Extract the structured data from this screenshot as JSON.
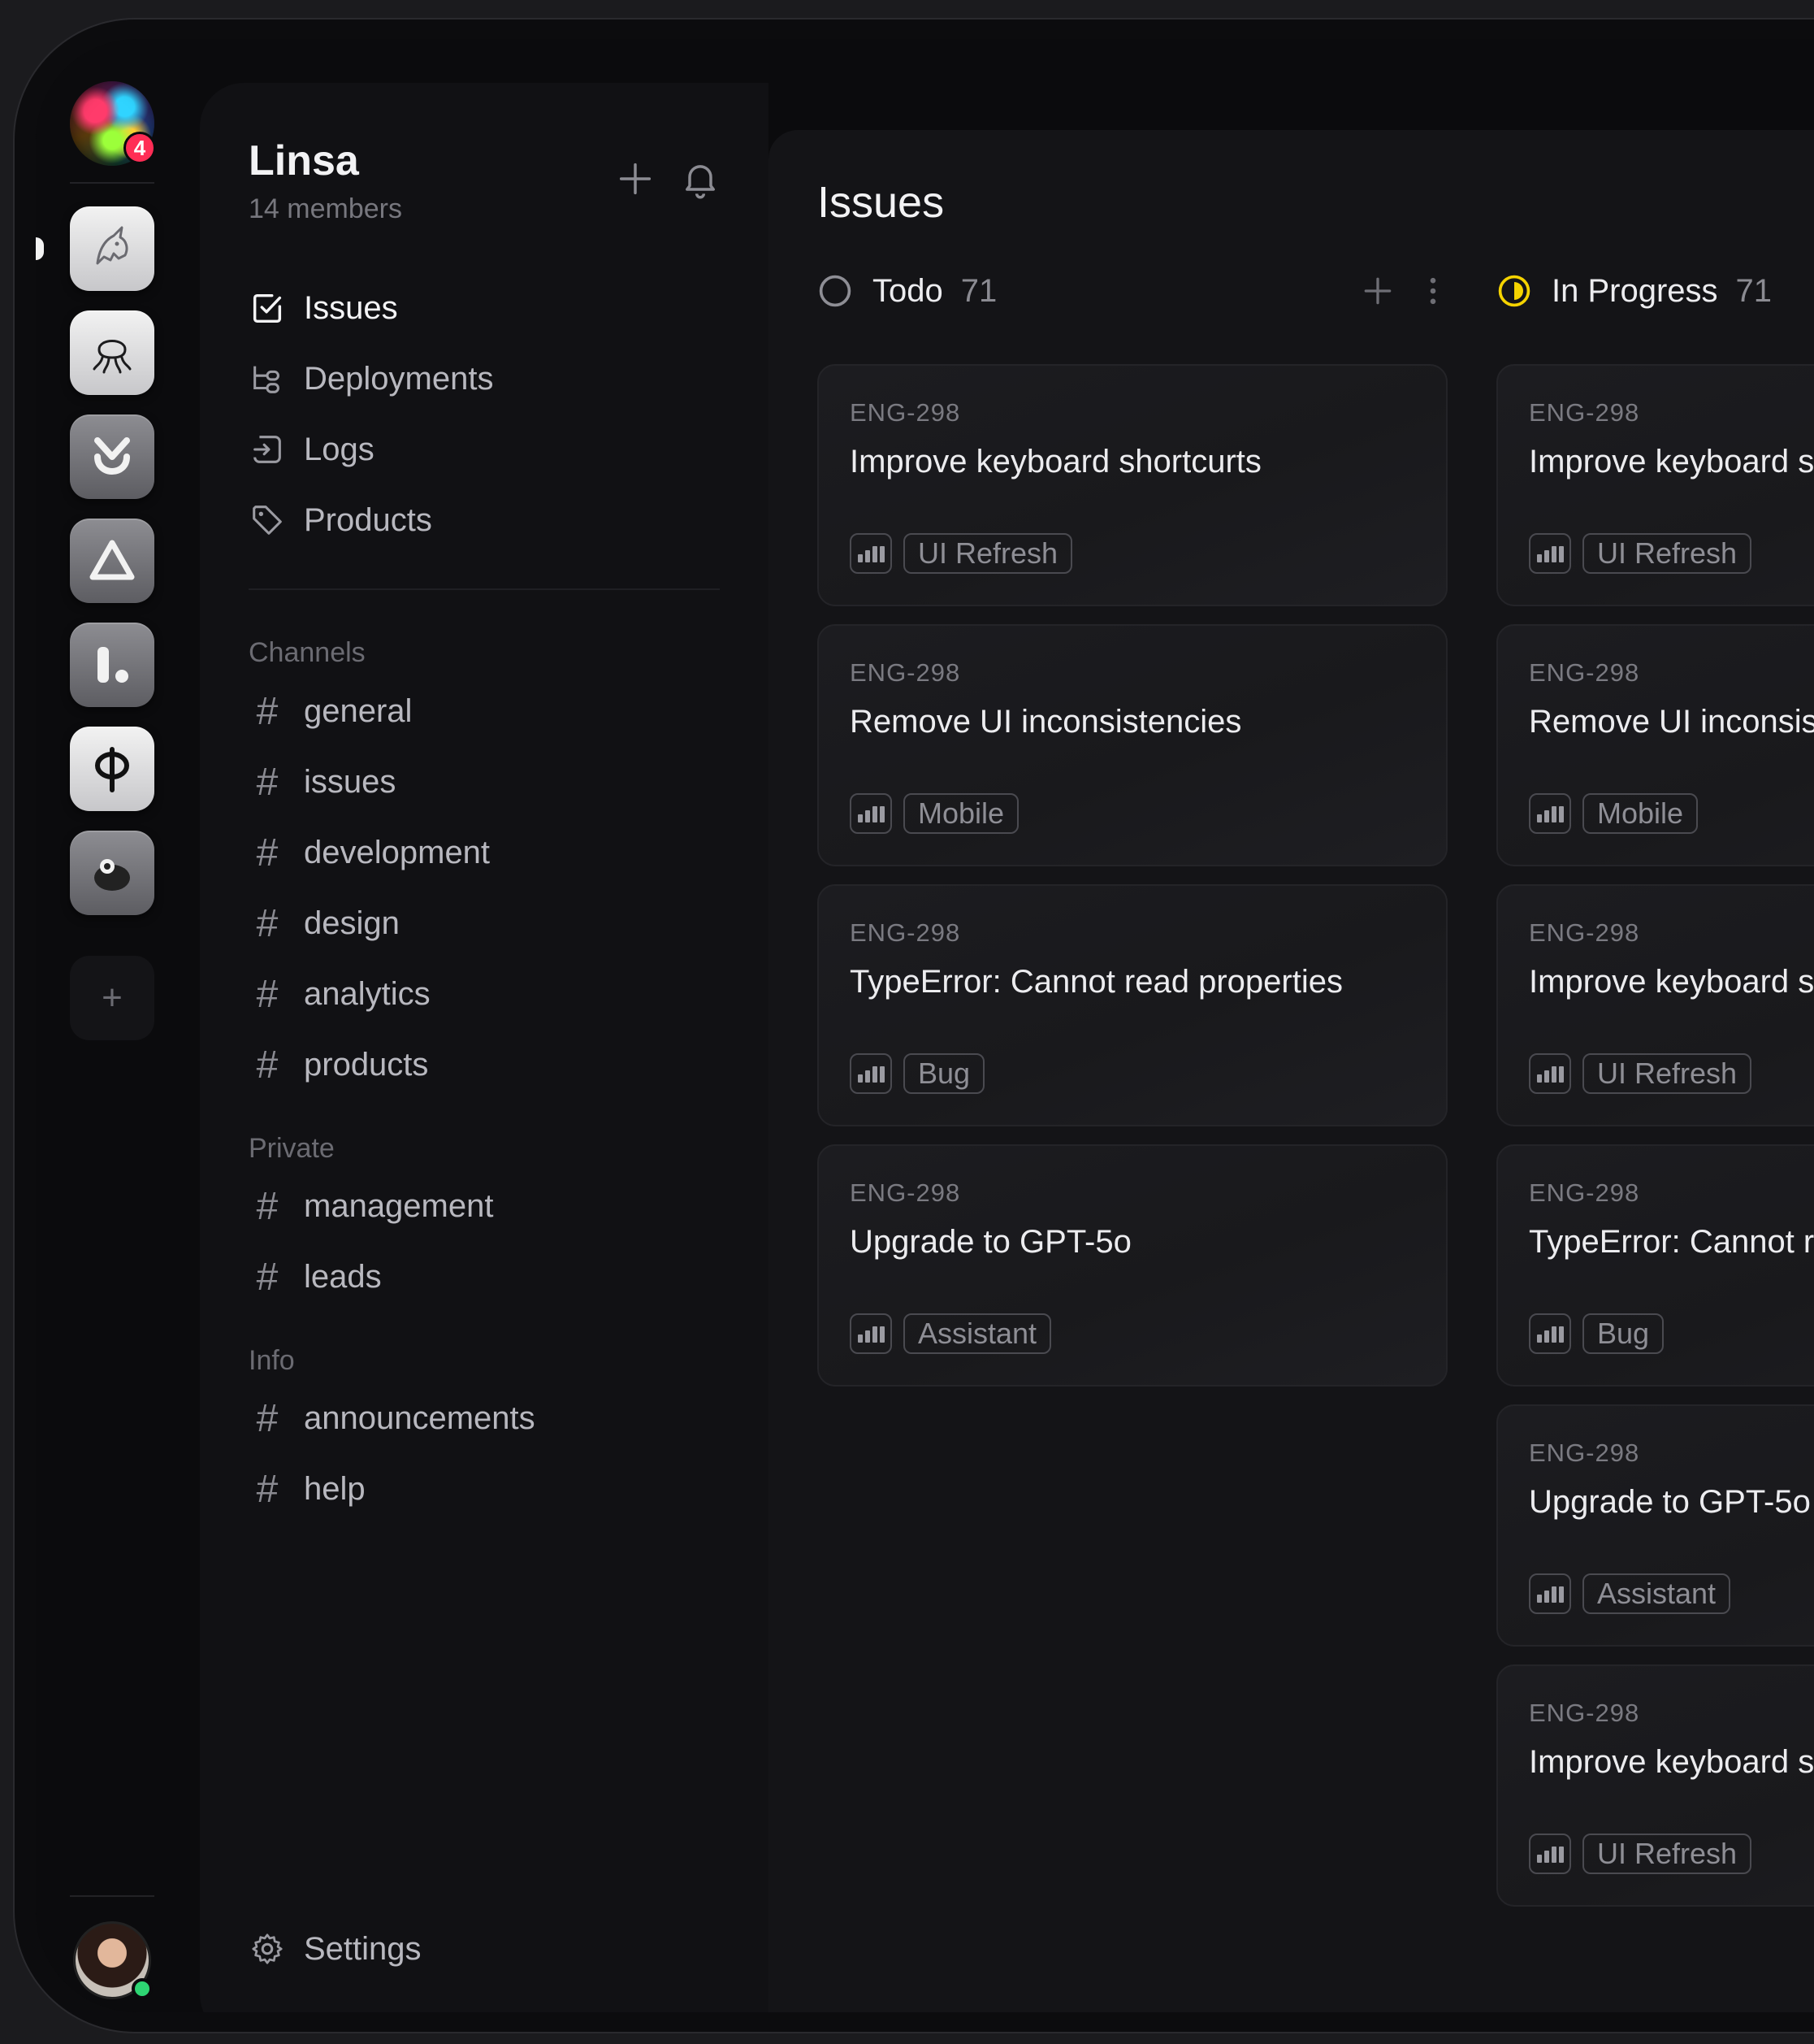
{
  "rail": {
    "notification_count": "4",
    "apps": [
      {
        "name": "unicorn-app-icon"
      },
      {
        "name": "octopus-app-icon"
      },
      {
        "name": "y-app-icon"
      },
      {
        "name": "triangle-app-icon"
      },
      {
        "name": "l-dot-app-icon"
      },
      {
        "name": "phi-app-icon"
      },
      {
        "name": "blob-app-icon"
      }
    ],
    "add_label": "+"
  },
  "sidebar": {
    "team_name": "Linsa",
    "members": "14 members",
    "nav": [
      {
        "label": "Issues",
        "icon": "checkbox-icon",
        "active": true
      },
      {
        "label": "Deployments",
        "icon": "tree-icon"
      },
      {
        "label": "Logs",
        "icon": "log-icon"
      },
      {
        "label": "Products",
        "icon": "tag-icon"
      }
    ],
    "sections": [
      {
        "label": "Channels",
        "channels": [
          "general",
          "issues",
          "development",
          "design",
          "analytics",
          "products"
        ]
      },
      {
        "label": "Private",
        "channels": [
          "management",
          "leads"
        ]
      },
      {
        "label": "Info",
        "channels": [
          "announcements",
          "help"
        ]
      }
    ],
    "settings_label": "Settings"
  },
  "main": {
    "title": "Issues",
    "columns": [
      {
        "name": "Todo",
        "count": "71",
        "status_color": "#8e8e95",
        "cards": [
          {
            "id": "ENG-298",
            "title": "Improve keyboard shortcurts",
            "tag": "UI Refresh"
          },
          {
            "id": "ENG-298",
            "title": "Remove UI inconsistencies",
            "tag": "Mobile"
          },
          {
            "id": "ENG-298",
            "title": "TypeError: Cannot read properties",
            "tag": "Bug"
          },
          {
            "id": "ENG-298",
            "title": "Upgrade to GPT-5o",
            "tag": "Assistant"
          }
        ]
      },
      {
        "name": "In Progress",
        "count": "71",
        "status_color": "#f5d300",
        "cards": [
          {
            "id": "ENG-298",
            "title": "Improve keyboard shortcurts",
            "tag": "UI Refresh"
          },
          {
            "id": "ENG-298",
            "title": "Remove UI inconsistencies",
            "tag": "Mobile"
          },
          {
            "id": "ENG-298",
            "title": "Improve keyboard shortcurts",
            "tag": "UI Refresh"
          },
          {
            "id": "ENG-298",
            "title": "TypeError: Cannot read properties",
            "tag": "Bug"
          },
          {
            "id": "ENG-298",
            "title": "Upgrade to GPT-5o",
            "tag": "Assistant"
          },
          {
            "id": "ENG-298",
            "title": "Improve keyboard shortcurts",
            "tag": "UI Refresh"
          }
        ]
      }
    ]
  }
}
